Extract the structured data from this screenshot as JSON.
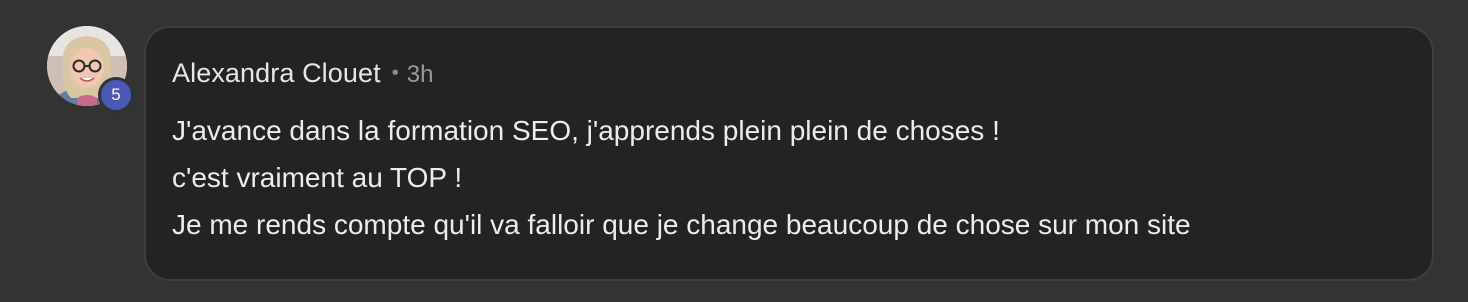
{
  "comment": {
    "author": "Alexandra Clouet",
    "separator": "•",
    "time": "3h",
    "level": "5",
    "lines": [
      "J'avance dans la formation SEO, j'apprends plein plein de choses !",
      "c'est vraiment au TOP !",
      "Je me rends compte qu'il va falloir que je change beaucoup de chose sur mon site"
    ]
  },
  "colors": {
    "page_background": "#333333",
    "bubble_background": "#232323",
    "bubble_border": "#3e3e3e",
    "badge": "#4a58b8",
    "text": "#ececec",
    "muted": "#9a9a9a"
  }
}
